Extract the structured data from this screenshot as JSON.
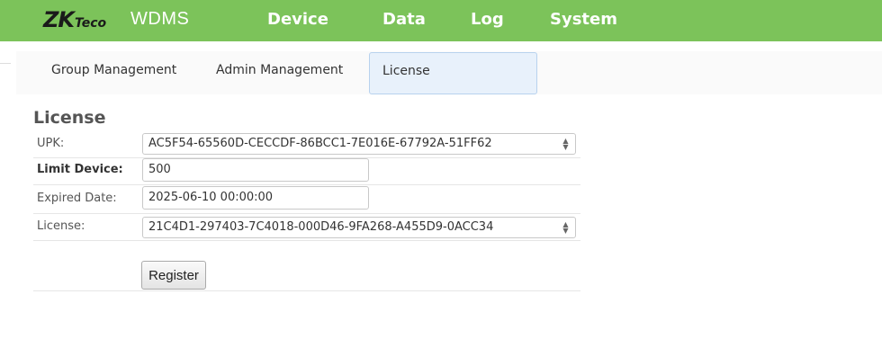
{
  "header": {
    "logo_main": "ZK",
    "logo_sub": "Teco",
    "app_name": "WDMS",
    "nav": [
      "Device",
      "Data",
      "Log",
      "System"
    ]
  },
  "subnav": {
    "tabs": [
      "Group Management",
      "Admin Management",
      "License"
    ],
    "active": "License"
  },
  "license_form": {
    "title": "License",
    "upk_label": "UPK:",
    "upk_value": "AC5F54-65560D-CECCDF-86BCC1-7E016E-67792A-51FF62",
    "limit_label": "Limit Device:",
    "limit_value": "500",
    "expired_label": "Expired Date:",
    "expired_value": "2025-06-10 00:00:00",
    "license_label": "License:",
    "license_value": "21C4D1-297403-7C4018-000D46-9FA268-A455D9-0ACC34",
    "register_label": "Register"
  },
  "colors": {
    "topbar": "#7cc35a",
    "active_tab_bg": "#e8f1fb"
  },
  "icons": {
    "spinner": "updown-spinner-icon"
  }
}
